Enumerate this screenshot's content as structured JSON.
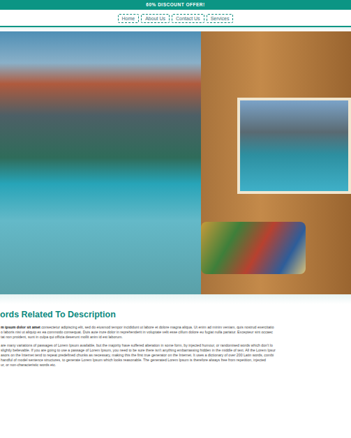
{
  "banner": {
    "text": "60% DISCOUNT OFFER!"
  },
  "nav": {
    "items": [
      {
        "label": "Home",
        "selected": false
      },
      {
        "label": "About Us",
        "selected": false
      },
      {
        "label": "Contact Us",
        "selected": false
      },
      {
        "label": "Services",
        "selected": false
      }
    ]
  },
  "hero": {
    "kind": "photo"
  },
  "section": {
    "heading": "ords Related To Description",
    "paragraphs": [
      {
        "lines": [
          {
            "lead": "m ipsum dolor sit amet",
            "text": " consectetur adipiscing elit, sed do eiusmod tempor incididunt ut labore et dolore magna aliqua. Ut enim ad minim veniam, quis nostrud exercitatio"
          },
          {
            "lead": "",
            "text": "o laboris nisi ut aliquip ex ea commodo consequat. Duis aute irure dolor in reprehenderit in voluptate velit esse cillum dolore eu fugiat nulla pariatur. Excepteur sint occaec"
          },
          {
            "lead": "",
            "text": "tat non proident, sunt in culpa qui officia deserunt mollit anim id est laborum."
          }
        ]
      },
      {
        "lines": [
          {
            "lead": "",
            "text": "are many variations of passages of Lorem Ipsum available, but the majority have suffered alteration in some form, by injected humour, or randomised words which don't lo"
          },
          {
            "lead": "",
            "text": "slightly believable. If you are going to use a passage of Lorem Ipsum, you need to be sure there isn't anything embarrassing hidden in the middle of text. All the Lorem Ipsur"
          },
          {
            "lead": "",
            "text": "asors on the Internet tend to repeat predefined chunks as necessary, making this the first true generator on the Internet. It uses a dictionary of over 200 Latin words, combi"
          },
          {
            "lead": "",
            "text": "handful of model sentence structures, to generate Lorem Ipsum which looks reasonable. The generated Lorem Ipsum is therefore always free from repetition, injected"
          },
          {
            "lead": "",
            "text": "ur, or non-characteristic words etc."
          }
        ]
      }
    ]
  }
}
